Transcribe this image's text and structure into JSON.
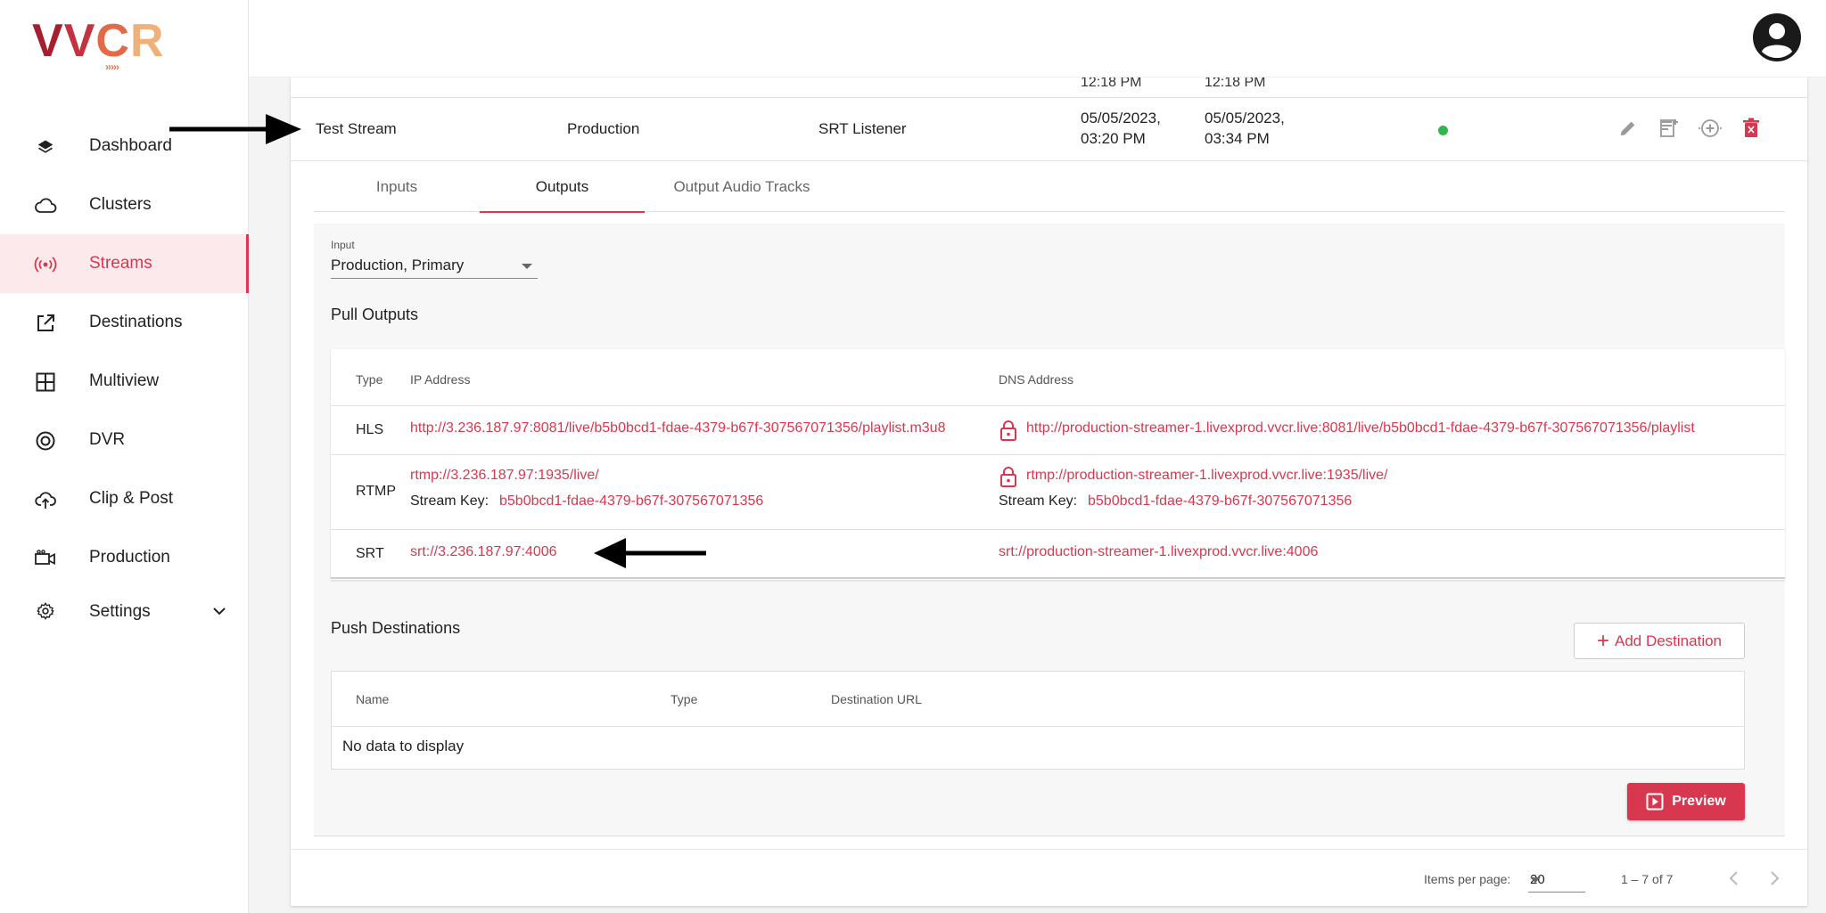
{
  "brand": {
    "logo_letters": [
      "V",
      "V",
      "C",
      "R"
    ],
    "logo_chevrons": "›››››"
  },
  "sidebar": {
    "items": [
      {
        "label": "Dashboard",
        "icon": "layers-icon"
      },
      {
        "label": "Clusters",
        "icon": "cloud-icon"
      },
      {
        "label": "Streams",
        "icon": "broadcast-icon",
        "active": true
      },
      {
        "label": "Destinations",
        "icon": "external-link-icon"
      },
      {
        "label": "Multiview",
        "icon": "grid-icon"
      },
      {
        "label": "DVR",
        "icon": "disc-icon"
      },
      {
        "label": "Clip & Post",
        "icon": "cloud-upload-icon"
      },
      {
        "label": "Production",
        "icon": "video-camera-icon"
      },
      {
        "label": "Settings",
        "icon": "gear-icon",
        "expandable": true
      }
    ]
  },
  "previous_row": {
    "start_time_fragment": "12:18 PM",
    "end_time_fragment": "12:18 PM"
  },
  "stream_row": {
    "name": "Test Stream",
    "cluster": "Production",
    "type": "SRT Listener",
    "created_date": "05/05/2023,",
    "created_time": "03:20 PM",
    "updated_date": "05/05/2023,",
    "updated_time": "03:34 PM",
    "status_color": "#2eb84b"
  },
  "tabs": [
    {
      "label": "Inputs"
    },
    {
      "label": "Outputs",
      "active": true
    },
    {
      "label": "Output Audio Tracks"
    }
  ],
  "input_select": {
    "label": "Input",
    "value": "Production, Primary"
  },
  "pull_outputs": {
    "title": "Pull Outputs",
    "headers": {
      "type": "Type",
      "ip": "IP Address",
      "dns": "DNS Address"
    },
    "hls": {
      "type": "HLS",
      "ip": "http://3.236.187.97:8081/live/b5b0bcd1-fdae-4379-b67f-307567071356/playlist.m3u8",
      "dns": "http://production-streamer-1.livexprod.vvcr.live:8081/live/b5b0bcd1-fdae-4379-b67f-307567071356/playlist"
    },
    "rtmp": {
      "type": "RTMP",
      "ip": "rtmp://3.236.187.97:1935/live/",
      "dns": "rtmp://production-streamer-1.livexprod.vvcr.live:1935/live/",
      "key_label": "Stream Key:",
      "key": "b5b0bcd1-fdae-4379-b67f-307567071356"
    },
    "srt": {
      "type": "SRT",
      "ip": "srt://3.236.187.97:4006",
      "dns": "srt://production-streamer-1.livexprod.vvcr.live:4006"
    }
  },
  "push_destinations": {
    "title": "Push Destinations",
    "add_label": "Add Destination",
    "headers": {
      "name": "Name",
      "type": "Type",
      "url": "Destination URL"
    },
    "empty_text": "No data to display"
  },
  "preview_label": "Preview",
  "paginator": {
    "items_per_page_label": "Items per page:",
    "page_size": "20",
    "range": "1 – 7 of 7"
  },
  "colors": {
    "accent": "#d8384f",
    "active_bg": "#fce9ec",
    "status_green": "#2eb84b"
  }
}
